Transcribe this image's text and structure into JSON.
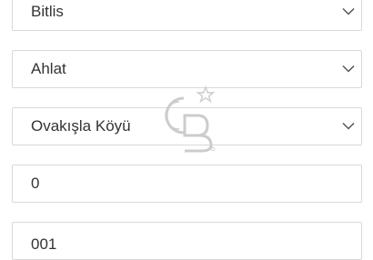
{
  "form": {
    "province": {
      "selected": "Bitlis"
    },
    "district": {
      "selected": "Ahlat"
    },
    "neighborhood": {
      "selected": "Ovakışla Köyü"
    },
    "field_4": {
      "value": "0"
    },
    "field_5": {
      "value": "001"
    }
  },
  "icons": {
    "dropdown": "chevron-down-icon",
    "watermark": "coldwell-banker-logo"
  },
  "colors": {
    "border": "#d8d8d8",
    "text": "#333333",
    "chevron": "#555555",
    "watermark": "#cccccc"
  }
}
